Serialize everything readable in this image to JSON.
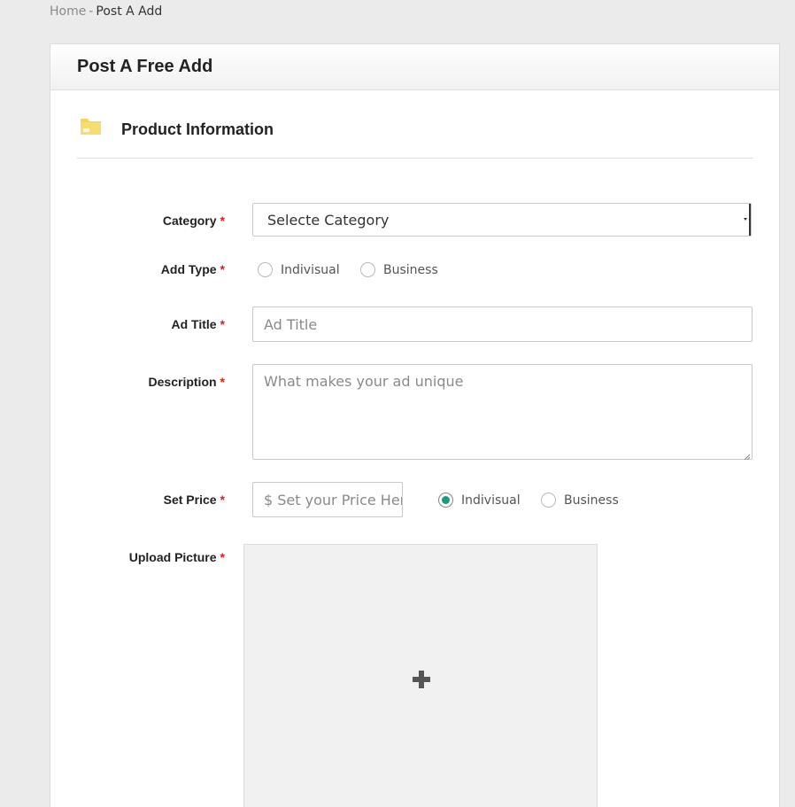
{
  "breadcrumb": {
    "home": "Home",
    "separator": "-",
    "current": "Post A Add"
  },
  "panel": {
    "title": "Post A Free Add"
  },
  "section": {
    "title": "Product Information",
    "icon": "folder-icon",
    "icon_color": "#f4d35e"
  },
  "form": {
    "required_marker": "*",
    "category": {
      "label": "Category",
      "selected": "Selecte Category"
    },
    "add_type": {
      "label": "Add Type",
      "options": [
        "Indivisual",
        "Business"
      ],
      "selected": null
    },
    "ad_title": {
      "label": "Ad Title",
      "placeholder": "Ad Title",
      "value": ""
    },
    "description": {
      "label": "Description",
      "placeholder": "What makes your ad unique",
      "value": ""
    },
    "set_price": {
      "label": "Set Price",
      "placeholder": "$ Set your Price Here",
      "options": [
        "Indivisual",
        "Business"
      ],
      "selected": "Indivisual"
    },
    "upload_picture": {
      "label": "Upload Picture",
      "icon": "plus-icon"
    }
  },
  "colors": {
    "required": "#e31b1b",
    "radio_checked": "#1a9b7d",
    "background": "#ebebeb"
  }
}
